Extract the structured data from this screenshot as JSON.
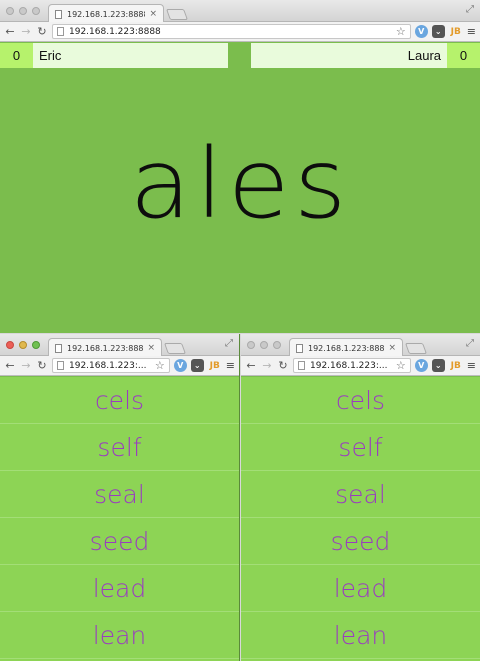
{
  "main": {
    "tab_title": "192.168.1.223:8888",
    "url": "192.168.1.223:8888",
    "player_left": {
      "score": "0",
      "name": "Eric"
    },
    "player_right": {
      "score": "0",
      "name": "Laura"
    },
    "word": "ales"
  },
  "left": {
    "tab_title": "192.168.1.223:8888",
    "url": "192.168.1.223:...",
    "words": [
      "cels",
      "self",
      "seal",
      "seed",
      "lead",
      "lean"
    ]
  },
  "right": {
    "tab_title": "192.168.1.223:8888",
    "url": "192.168.1.223:...",
    "words": [
      "cels",
      "self",
      "seal",
      "seed",
      "lead",
      "lean"
    ]
  },
  "icons": {
    "close": "×",
    "expand": "⤢",
    "back": "←",
    "forward": "→",
    "reload": "↻",
    "star": "☆",
    "menu": "≡",
    "ext_v": "V",
    "ext_pocket": "⌄",
    "ext_jb": "JB"
  },
  "colors": {
    "page_bg": "#7bbd4d",
    "list_bg": "#8dd455",
    "word_color": "#9a3cc0",
    "score_bg": "#b6f26c",
    "player_bg": "#e9fbdc"
  }
}
